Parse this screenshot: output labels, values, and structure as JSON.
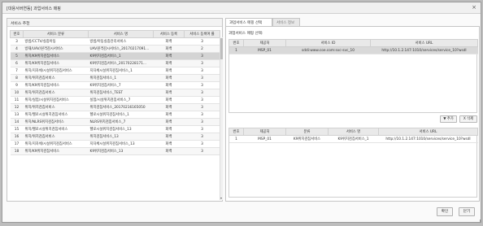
{
  "window": {
    "title": "[대용서버연동] 과업서비스 매핑",
    "close_glyph": "×"
  },
  "left_panel": {
    "title": "서비스 추천",
    "columns": [
      "번호",
      "서비스 분류",
      "서비스 명",
      "서비스 등록",
      "서비스 등록여 률"
    ],
    "rows": [
      [
        "3",
        "방범/CCTV/실종아동",
        "방범/아동실종관리서비스",
        "화백",
        "3"
      ],
      [
        "4",
        "방재/UAV/원격감시서비스",
        "UAV원격감시서비스_20170217091...",
        "화백",
        "2"
      ],
      [
        "5",
        "위치/K9위치검침서비스",
        "K9위치검침서비스_1",
        "화백",
        "3"
      ],
      [
        "6",
        "위치/K9위치검침서비스",
        "K9위치검침서비스_20170228171...",
        "화백",
        "3"
      ],
      [
        "7",
        "위치/지자체/시설위치검침서비스",
        "지자체시설위치검침서비스_1",
        "화백",
        "3"
      ],
      [
        "8",
        "위치/위치검침서비스",
        "위치검침서비스_1",
        "화백",
        "3"
      ],
      [
        "9",
        "위치/K9위치검침서비스",
        "K9위치검침서비스_7",
        "화백",
        "3"
      ],
      [
        "10",
        "위치/위치검침서비스",
        "위치검침서비스_TEST",
        "화백",
        "3"
      ],
      [
        "11",
        "위치/실험/시설위치검침서비스",
        "실험/시설위치검침서비스_7",
        "화백",
        "3"
      ],
      [
        "12",
        "위치/위치검침서비스",
        "위치검침서비스_20170216165050",
        "화백",
        "3"
      ],
      [
        "13",
        "위치/헬로시설위치검침서비스",
        "헬로시설위치검침서비스_1",
        "화백",
        "3"
      ],
      [
        "14",
        "위치/NLRS위치검침서비스",
        "NLRS위치검침서비스_7",
        "화백",
        "3"
      ],
      [
        "15",
        "위치/헬로시설위치검침서비스",
        "헬로시설위치검침서비스_13",
        "화백",
        "3"
      ],
      [
        "16",
        "위치/위치검침서비스",
        "위치검침서비스_13",
        "화백",
        "3"
      ],
      [
        "17",
        "위치/지자체/시설위치검침서비스",
        "지자체시설위치검침서비스_13",
        "화백",
        "3"
      ],
      [
        "18",
        "위치/K9위치검침서비스",
        "K9위치검침서비스_13",
        "화백",
        "3"
      ]
    ]
  },
  "right_panel": {
    "tabs": [
      "과업서비스 매핑 선택",
      "서비스 정보"
    ],
    "top_label": "과업서비스 매핑 선택:",
    "top_columns": [
      "번호",
      "제공처",
      "서비스 ID",
      "서비스 URL"
    ],
    "top_rows": [
      [
        "1",
        "MSP_01",
        "sddi:www.coe.com:svc-svc_10",
        "http://10.1.2.147:1010/services/service_10?wsdl"
      ]
    ],
    "add_button": "▼ 추가",
    "delete_button": "X 삭제",
    "bottom_columns": [
      "번호",
      "제공처",
      "분류",
      "서비스 명",
      "서비스 URL"
    ],
    "bottom_rows": [
      [
        "1",
        "MSP_01",
        "K9위치검침서비스",
        "K9위치검침서비스_1",
        "http://10.1.2.147:1010/services/service_10?wsdl"
      ]
    ]
  },
  "footer": {
    "confirm_label": "확인",
    "close_label": "닫기"
  }
}
